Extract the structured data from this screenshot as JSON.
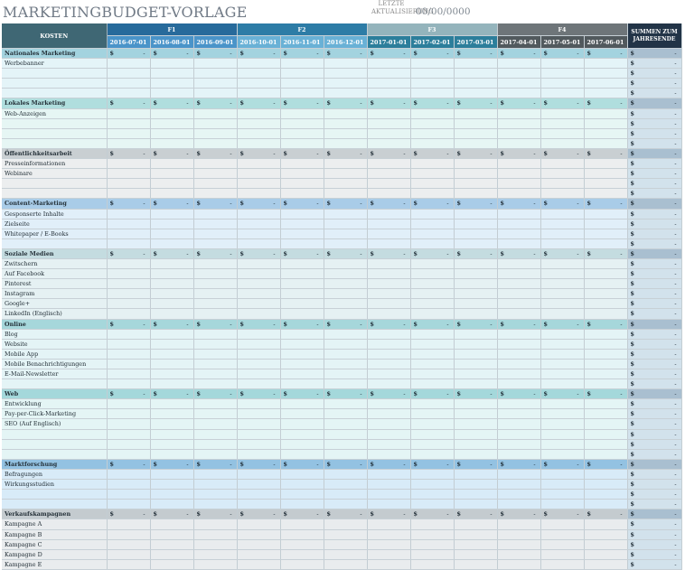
{
  "title": "MARKETINGBUDGET-VORLAGE",
  "last_updated_label": "LETZTE AKTUALISIERUNG",
  "last_updated_value": "00/00/0000",
  "header": {
    "kosten": "KOSTEN",
    "quarters": [
      "F1",
      "F2",
      "F3",
      "F4"
    ],
    "months": [
      "2016-07-01",
      "2016-08-01",
      "2016-09-01",
      "2016-10-01",
      "2016-11-01",
      "2016-12-01",
      "2017-01-01",
      "2017-02-01",
      "2017-03-01",
      "2017-04-01",
      "2017-05-01",
      "2017-06-01"
    ],
    "sum_label": "SUMMEN ZUM JAHRESENDE"
  },
  "currency": "$",
  "zero": "-",
  "colors": {
    "cat_bg": [
      "#a3d3df",
      "#b0dede",
      "#c9cfd2",
      "#a9cce8",
      "#c4dce0",
      "#a6d7db",
      "#a4d8db",
      "#93c2e2",
      "#c4cbcf"
    ],
    "row_bg": [
      "#e4f4f8",
      "#e6f6f4",
      "#eceeef",
      "#e1eff9",
      "#e5f1f3",
      "#e4f4f6",
      "#e4f5f5",
      "#d8ebf8",
      "#e9ecee"
    ],
    "sum_bg": "#d2e2ec",
    "sum_cat_bg": "#a9bfd0"
  },
  "sections": [
    {
      "name": "Nationales Marketing",
      "items": [
        "Werbebanner",
        "",
        "",
        ""
      ]
    },
    {
      "name": "Lokales Marketing",
      "items": [
        "Web-Anzeigen",
        "",
        "",
        ""
      ]
    },
    {
      "name": "Öffentlichkeitsarbeit",
      "items": [
        "Presseinformationen",
        "Webinare",
        "",
        ""
      ]
    },
    {
      "name": "Content-Marketing",
      "items": [
        "Gesponserte Inhalte",
        "Zielseite",
        "Whitepaper / E-Books",
        ""
      ]
    },
    {
      "name": "Soziale Medien",
      "items": [
        "Zwitschern",
        "Auf Facebook",
        "Pinterest",
        "Instagram",
        "Google+",
        "LinkedIn (Englisch)"
      ]
    },
    {
      "name": "Online",
      "items": [
        "Blog",
        "Website",
        "Mobile App",
        "Mobile Benachrichtigungen",
        "E-Mail-Newsletter",
        ""
      ]
    },
    {
      "name": "Web",
      "items": [
        "Entwicklung",
        "Pay-per-Click-Marketing",
        "SEO (Auf Englisch)",
        "",
        "",
        ""
      ]
    },
    {
      "name": "Marktforschung",
      "items": [
        "Befragungen",
        "Wirkungsstudien",
        "",
        ""
      ]
    },
    {
      "name": "Verkaufskampagnen",
      "items": [
        "Kampagne A",
        "Kampagne B",
        "Kampagne C",
        "Kampagne D",
        "Kampagne E"
      ]
    }
  ]
}
